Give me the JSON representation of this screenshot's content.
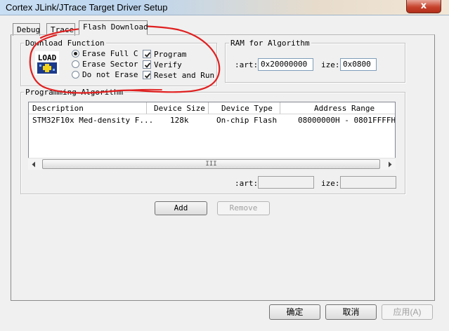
{
  "window": {
    "title": "Cortex JLink/JTrace Target Driver Setup",
    "close_label": "x"
  },
  "tabs": [
    {
      "label": "Debug"
    },
    {
      "label": "Trace"
    },
    {
      "label": "Flash Download"
    }
  ],
  "download_function": {
    "legend": "Download Function",
    "load_icon_text": "LOAD",
    "radios": [
      {
        "label": "Erase Full C",
        "selected": true
      },
      {
        "label": "Erase Sector",
        "selected": false
      },
      {
        "label": "Do not Erase",
        "selected": false
      }
    ],
    "checks": [
      {
        "label": "Program",
        "checked": true
      },
      {
        "label": "Verify",
        "checked": true
      },
      {
        "label": "Reset and Run",
        "checked": true
      }
    ]
  },
  "ram": {
    "legend": "RAM for Algorithm",
    "start_label": ":art:",
    "start_value": "0x20000000",
    "size_label": "ize:",
    "size_value": "0x0800"
  },
  "programming": {
    "legend": "Programming Algorithm",
    "columns": [
      "Description",
      "Device Size",
      "Device Type",
      "Address Range"
    ],
    "rows": [
      [
        "STM32F10x Med-density F...",
        "128k",
        "On-chip Flash",
        "08000000H - 0801FFFFH"
      ]
    ],
    "scroll_grip": "III",
    "start_label": ":art:",
    "start_value": "",
    "size_label": "ize:",
    "size_value": ""
  },
  "buttons": {
    "add": "Add",
    "remove": "Remove",
    "ok": "确定",
    "cancel": "取消",
    "apply": "应用(A)"
  },
  "colors": {
    "annotation": "#e02020"
  }
}
